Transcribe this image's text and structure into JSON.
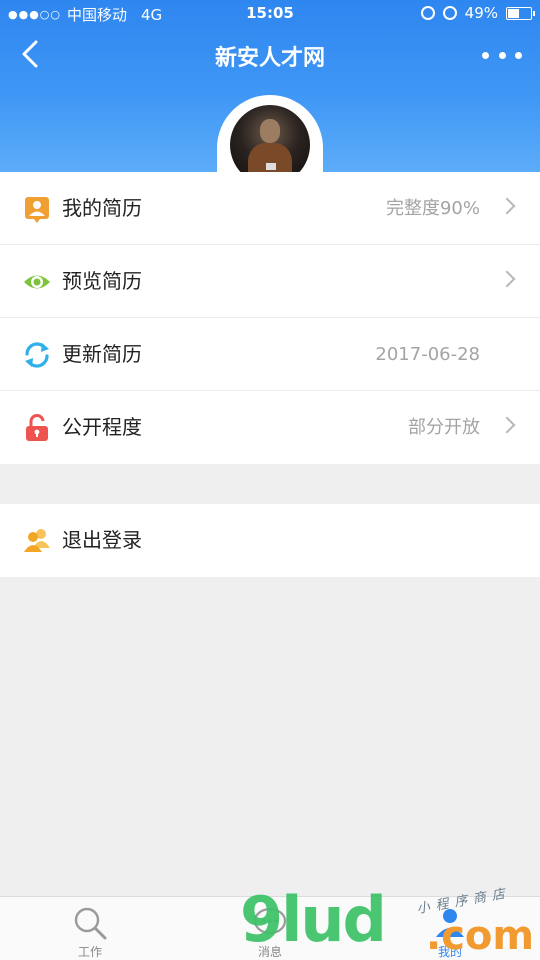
{
  "status_bar": {
    "signal": "●●●○○",
    "carrier": "中国移动",
    "network": "4G",
    "time": "15:05",
    "battery": "49%",
    "battery_level": 0.49
  },
  "nav": {
    "title": "新安人才网",
    "back_icon": "chevron-left-icon",
    "more_icon": "more-dots-icon"
  },
  "menu": {
    "items": [
      {
        "label": "我的简历",
        "value": "完整度90%",
        "icon": "resume-person-icon",
        "color": "#f0a033"
      },
      {
        "label": "预览简历",
        "value": "",
        "icon": "eye-icon",
        "color": "#7dc23a"
      },
      {
        "label": "更新简历",
        "value": "2017-06-28",
        "icon": "refresh-icon",
        "color": "#2fb0e8"
      },
      {
        "label": "公开程度",
        "value": "部分开放",
        "icon": "unlock-icon",
        "color": "#ef5350"
      }
    ],
    "logout": {
      "label": "退出登录",
      "icon": "users-icon",
      "color": "#f2a623"
    }
  },
  "tabs": [
    {
      "label": "工作",
      "icon": "search-icon"
    },
    {
      "label": "消息",
      "icon": "chat-bubble-icon"
    },
    {
      "label": "我的",
      "icon": "person-icon",
      "active": true
    }
  ],
  "watermark": {
    "brand": "9lud",
    "tld": ".com",
    "caption": "小程序商店"
  },
  "colors": {
    "primary": "#2f86ee",
    "background": "#efeff0"
  }
}
